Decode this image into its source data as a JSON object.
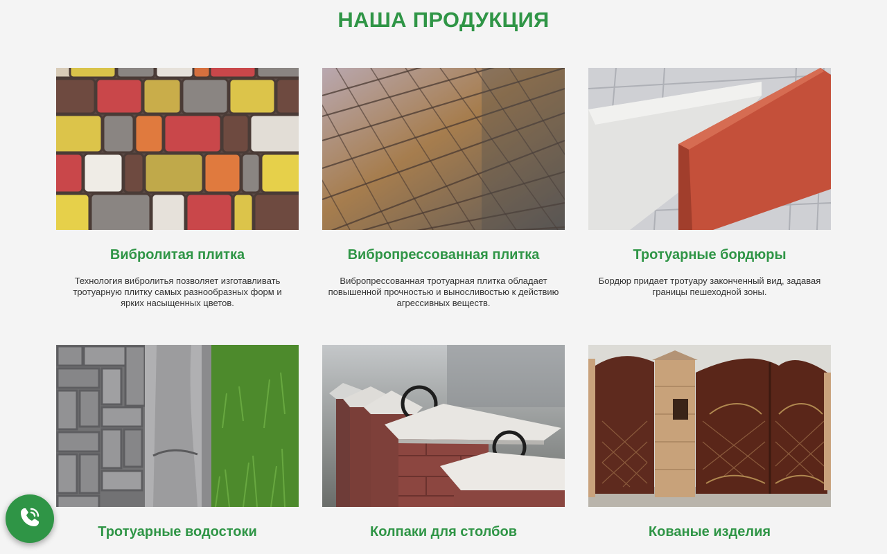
{
  "section": {
    "title": "НАША ПРОДУКЦИЯ"
  },
  "products": [
    {
      "title": "Вибролитая плитка",
      "description": "Технология вибролитья позволяет изготавливать тротуарную плитку самых разнообразных форм и ярких насыщенных цветов."
    },
    {
      "title": "Вибропрессованная плитка",
      "description": "Вибропрессованная тротуарная плитка обладает повышенной прочностью и выносливостью к действию агрессивных веществ."
    },
    {
      "title": "Тротуарные бордюры",
      "description": "Бордюр придает тротуару законченный вид, задавая границы пешеходной зоны."
    },
    {
      "title": "Тротуарные водостоки",
      "description": ""
    },
    {
      "title": "Колпаки для столбов",
      "description": ""
    },
    {
      "title": "Кованые изделия",
      "description": ""
    }
  ],
  "call_button": {
    "icon": "phone-icon"
  },
  "colors": {
    "accent": "#2f9546",
    "background": "#f4f4f4",
    "text": "#333333"
  }
}
